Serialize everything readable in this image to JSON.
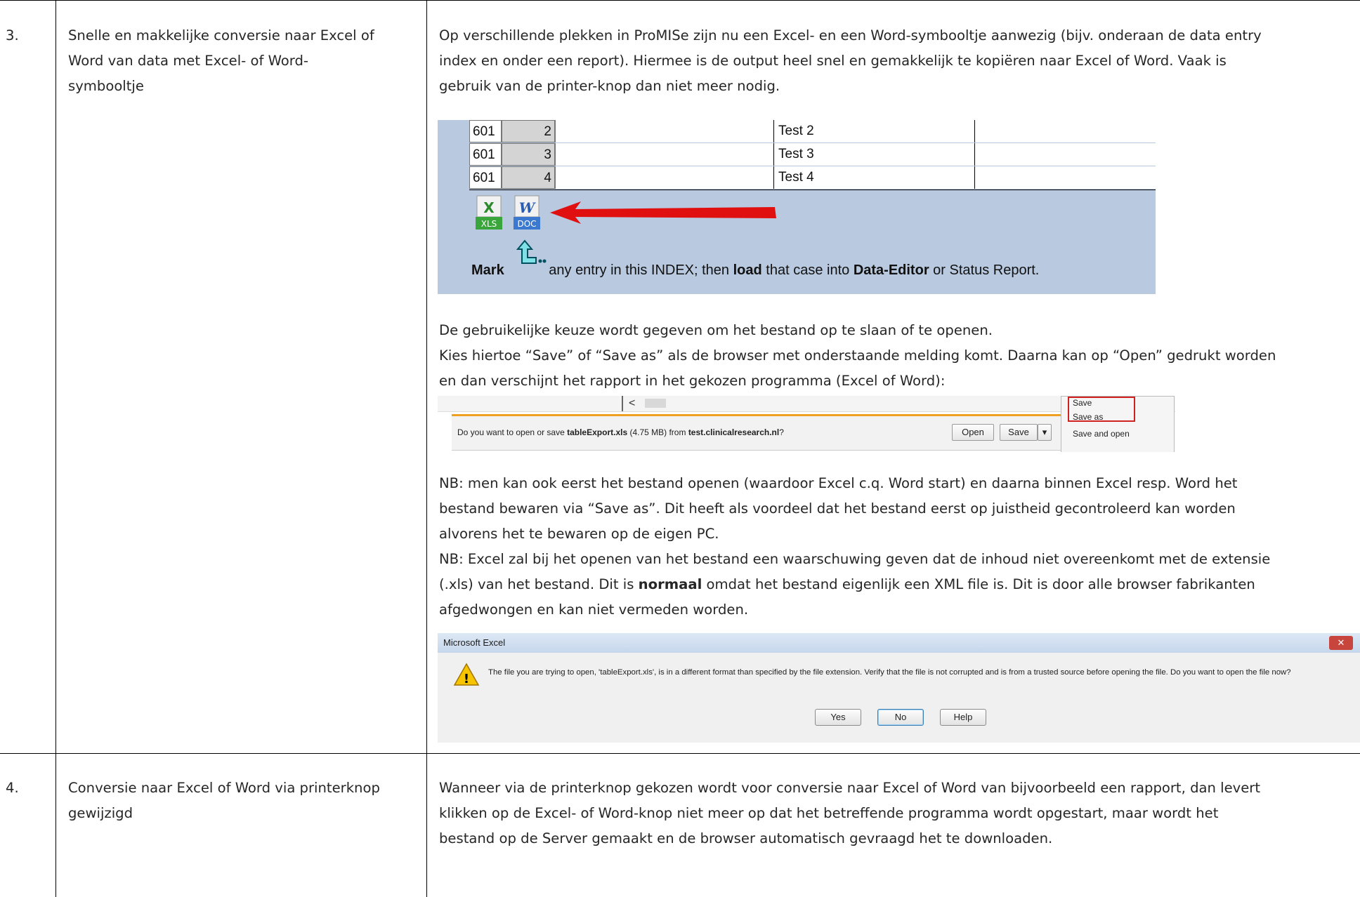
{
  "rows": [
    {
      "number": "3.",
      "description_lines": [
        "Snelle en makkelijke conversie naar Excel of",
        "Word van data met Excel- of Word-",
        "symbooltje"
      ],
      "intro_lines": [
        "Op verschillende plekken in ProMISe zijn nu een Excel- en een Word-symbooltje aanwezig (bijv. onderaan de data entry",
        "index en onder een report). Hiermee is de output heel snel en gemakkelijk te kopiëren naar Excel of Word. Vaak is",
        "gebruik van de printer-knop dan niet meer nodig."
      ],
      "save_lines": [
        "De gebruikelijke keuze wordt gegeven om  het bestand op te slaan of te openen.",
        "Kies hiertoe “Save” of “Save as” als de browser met onderstaande melding komt. Daarna kan op “Open” gedrukt worden",
        "en dan verschijnt het rapport in het gekozen programma (Excel of Word):"
      ],
      "nb1_lines": [
        "NB: men kan ook eerst het bestand openen (waardoor Excel c.q. Word start) en daarna binnen Excel resp. Word het",
        "bestand bewaren via “Save as”. Dit heeft als voordeel dat het bestand eerst op juistheid gecontroleerd kan worden",
        "alvorens het te bewaren op de eigen PC."
      ],
      "nb2_lines": [
        "NB: Excel zal bij het openen van het bestand een waarschuwing geven dat de inhoud niet overeenkomt met de extensie",
        "(.xls) van het bestand. Dit is ",
        "normaal",
        " omdat het bestand eigenlijk een XML file is. Dit is door alle browser fabrikanten",
        "afgedwongen en kan niet vermeden worden."
      ]
    },
    {
      "number": "4.",
      "description_lines": [
        "Conversie naar Excel of Word via printerknop",
        "gewijzigd"
      ],
      "body_lines": [
        "Wanneer via de printerknop gekozen wordt voor conversie naar Excel of Word van bijvoorbeeld een rapport, dan levert",
        "klikken op de Excel- of Word-knop niet meer  op dat het betreffende programma wordt opgestart, maar wordt het",
        "bestand op de Server gemaakt en de browser automatisch gevraagd het te downloaden."
      ]
    }
  ],
  "index_shot": {
    "rows": [
      {
        "id": "601",
        "seq": "2",
        "name": "Test 2"
      },
      {
        "id": "601",
        "seq": "3",
        "name": "Test 3"
      },
      {
        "id": "601",
        "seq": "4",
        "name": "Test 4"
      }
    ],
    "xls_label": "XLS",
    "doc_label": "DOC",
    "xls_glyph": "X",
    "doc_glyph": "W",
    "mark_parts": [
      "Mark",
      " any entry in this INDEX; then ",
      "load",
      " that case into ",
      "Data-Editor",
      " or Status Report."
    ],
    "icon_glyph": "‹",
    "arrow_color": "#e01010"
  },
  "download_shot": {
    "prompt_prefix": "Do you want to open or save ",
    "file_name": "tableExport.xls",
    "file_size": " (4.75 MB) from ",
    "host": "test.clinicalresearch.nl",
    "prompt_suffix": "?",
    "open_label": "Open",
    "save_label": "Save",
    "dropdown_glyph": "▾",
    "scroll_glyph": "<",
    "menu_items": [
      "Save",
      "Save as",
      "Save and open"
    ]
  },
  "excel_shot": {
    "title": "Microsoft Excel",
    "message": "The file you are trying to open, 'tableExport.xls', is in a different format than specified by the file extension. Verify that the file is not corrupted and is from a trusted source before opening the file. Do you want to open the file now?",
    "warning_glyph": "!",
    "close_glyph": "✕",
    "buttons": [
      "Yes",
      "No",
      "Help"
    ]
  }
}
